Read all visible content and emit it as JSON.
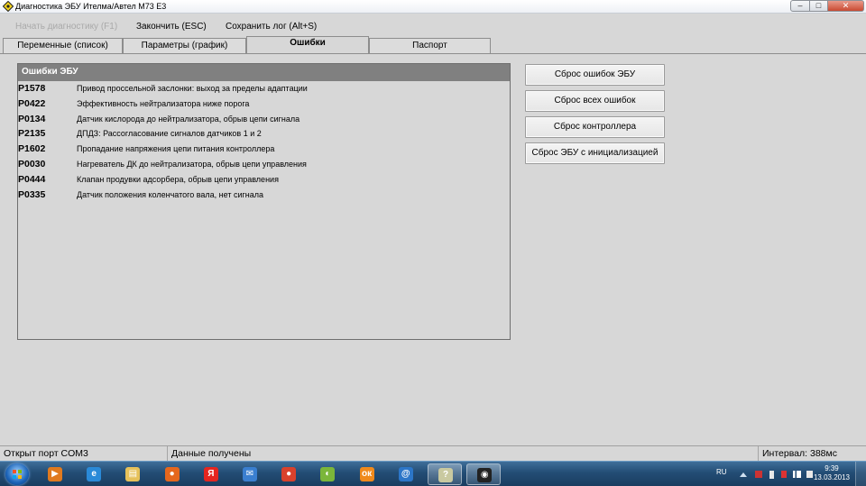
{
  "window": {
    "title": "Диагностика ЭБУ Ителма/Автел М73 Е3",
    "controls": {
      "minimize": "–",
      "maximize": "□",
      "close": "✕"
    }
  },
  "menu": {
    "start_diag": "Начать диагностику (F1)",
    "stop": "Закончить (ESC)",
    "save_log": "Сохранить лог (Alt+S)"
  },
  "tabs": [
    {
      "label": "Переменные (список)",
      "active": false
    },
    {
      "label": "Параметры (график)",
      "active": false
    },
    {
      "label": "Ошибки",
      "active": true
    },
    {
      "label": "Паспорт",
      "active": false
    }
  ],
  "errors_panel": {
    "header": "Ошибки ЭБУ",
    "rows": [
      {
        "code": "P1578",
        "description": "Привод проссельной заслонки: выход за пределы адаптации"
      },
      {
        "code": "P0422",
        "description": "Эффективность нейтрализатора ниже порога"
      },
      {
        "code": "P0134",
        "description": "Датчик кислорода до нейтрализатора, обрыв цепи сигнала"
      },
      {
        "code": "P2135",
        "description": "ДПДЗ: Рассогласование сигналов датчиков 1 и 2"
      },
      {
        "code": "P1602",
        "description": "Пропадание напряжения цепи питания контроллера"
      },
      {
        "code": "P0030",
        "description": "Нагреватель ДК до нейтрализатора, обрыв цепи управления"
      },
      {
        "code": "P0444",
        "description": "Клапан продувки адсорбера, обрыв цепи управления"
      },
      {
        "code": "P0335",
        "description": "Датчик положения коленчатого вала, нет сигнала"
      }
    ]
  },
  "actions": {
    "reset_ecu_errors": "Сброс ошибок ЭБУ",
    "reset_all_errors": "Сброс всех ошибок",
    "reset_controller": "Сброс контроллера",
    "reset_ecu_init": "Сброс ЭБУ с инициализацией"
  },
  "status": {
    "port": "Открыт порт COM3",
    "data": "Данные получены",
    "interval": "Интервал: 388мс"
  },
  "taskbar": {
    "apps": [
      {
        "name": "media-player-icon",
        "glyph": "▶",
        "color": "#e07a1f"
      },
      {
        "name": "internet-explorer-icon",
        "glyph": "e",
        "color": "#2a8ad8"
      },
      {
        "name": "file-explorer-icon",
        "glyph": "▤",
        "color": "#e6c15a"
      },
      {
        "name": "firefox-icon",
        "glyph": "●",
        "color": "#e5671d"
      },
      {
        "name": "yandex-browser-icon",
        "glyph": "Я",
        "color": "#e52620"
      },
      {
        "name": "mail-icon",
        "glyph": "✉",
        "color": "#3a7fd0"
      },
      {
        "name": "chrome-icon",
        "glyph": "●",
        "color": "#d9412c"
      },
      {
        "name": "orbit-icon",
        "glyph": "◐",
        "color": "#7bb63a"
      },
      {
        "name": "odnoklassniki-icon",
        "glyph": "ок",
        "color": "#f08a1c"
      },
      {
        "name": "mail-agent-icon",
        "glyph": "@",
        "color": "#2c76c8"
      },
      {
        "name": "help-tool-icon",
        "glyph": "?",
        "color": "#c9c9a0"
      },
      {
        "name": "diagnostic-app-icon",
        "glyph": "◉",
        "color": "#222222"
      }
    ],
    "language": "RU",
    "time": "9:39",
    "date": "13.03.2013"
  }
}
